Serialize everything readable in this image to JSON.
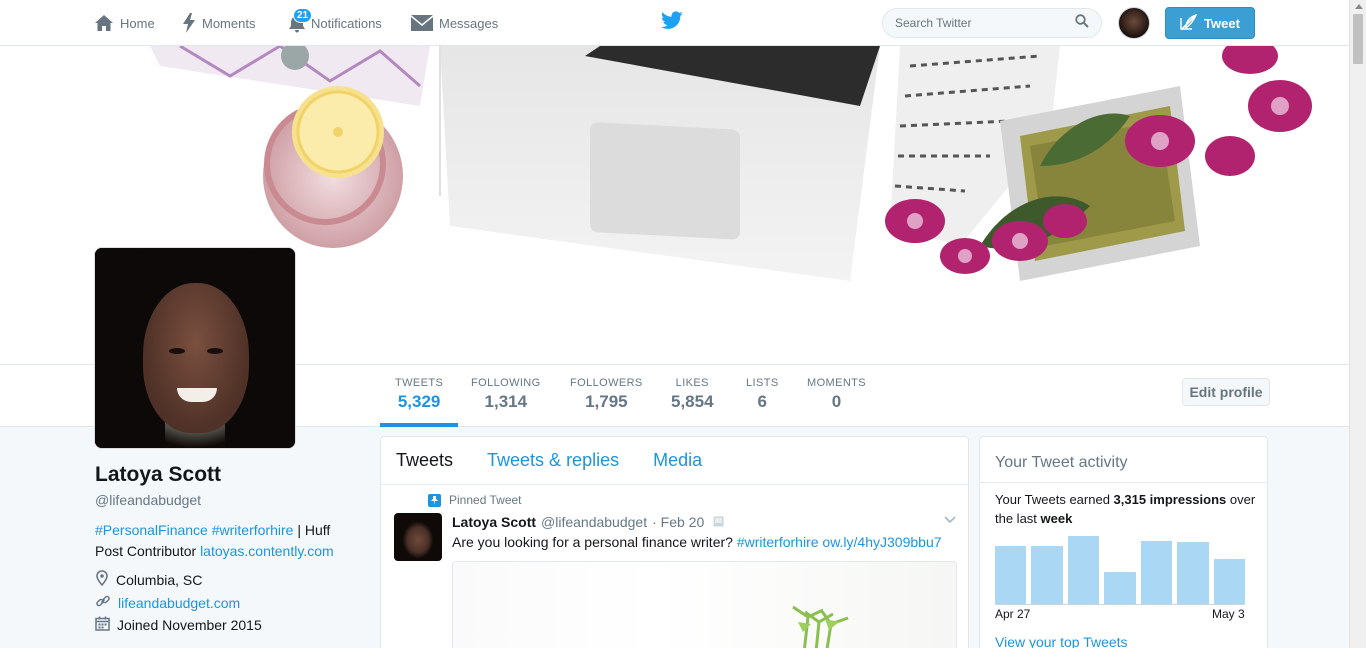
{
  "nav": {
    "home": "Home",
    "moments": "Moments",
    "notifications": "Notifications",
    "notifications_count": "21",
    "messages": "Messages"
  },
  "search": {
    "placeholder": "Search Twitter"
  },
  "tweet_button": "Tweet",
  "stats": [
    {
      "label": "TWEETS",
      "value": "5,329"
    },
    {
      "label": "FOLLOWING",
      "value": "1,314"
    },
    {
      "label": "FOLLOWERS",
      "value": "1,795"
    },
    {
      "label": "LIKES",
      "value": "5,854"
    },
    {
      "label": "LISTS",
      "value": "6"
    },
    {
      "label": "MOMENTS",
      "value": "0"
    }
  ],
  "edit_profile": "Edit profile",
  "profile": {
    "name": "Latoya Scott",
    "handle": "@lifeandabudget",
    "bio_tag1": "#PersonalFinance",
    "bio_tag2": "#writerforhire",
    "bio_text": " | Huff Post Contributor ",
    "bio_link": "latoyas.contently.com",
    "location": "Columbia, SC",
    "website": "lifeandabudget.com",
    "joined": "Joined November 2015"
  },
  "tabs": [
    "Tweets",
    "Tweets & replies",
    "Media"
  ],
  "pinned_tweet": {
    "label": "Pinned Tweet",
    "name": "Latoya Scott",
    "handle": "@lifeandabudget",
    "date": "· Feb 20",
    "text": "Are you looking for a personal finance writer? ",
    "hashtag": "#writerforhire",
    "link": "ow.ly/4hyJ309bbu7"
  },
  "activity": {
    "title": "Your Tweet activity",
    "text_pre": "Your Tweets earned ",
    "impressions": "3,315 impressions",
    "text_mid": " over the last ",
    "period": "week",
    "bars": [
      0.8,
      0.8,
      0.95,
      0.45,
      0.88,
      0.86,
      0.63
    ],
    "start_label": "Apr 27",
    "end_label": "May 3",
    "link": "View your top Tweets"
  },
  "colors": {
    "accent": "#1b95e0",
    "tweet_button": "#3c9fd4",
    "bar": "#aad8f4"
  }
}
